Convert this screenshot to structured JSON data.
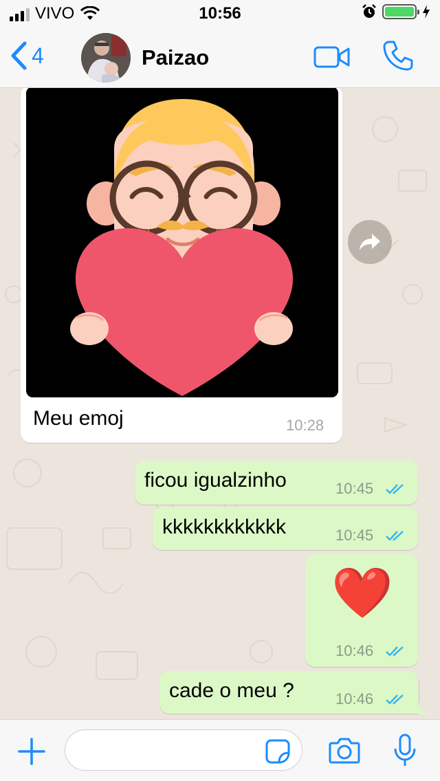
{
  "status_bar": {
    "carrier": "VIVO",
    "time": "10:56"
  },
  "header": {
    "back_count": "4",
    "contact_name": "Paizao"
  },
  "messages": [
    {
      "direction": "in",
      "type": "image",
      "caption": "Meu emoj",
      "time": "10:28"
    },
    {
      "direction": "out",
      "text": "ficou igualzinho",
      "time": "10:45",
      "read": true
    },
    {
      "direction": "out",
      "text": "kkkkkkkkkkkk",
      "time": "10:45",
      "read": true
    },
    {
      "direction": "out",
      "text": "❤️",
      "time": "10:46",
      "read": true
    },
    {
      "direction": "out",
      "text": "cade o meu ?",
      "time": "10:46",
      "read": true
    }
  ],
  "input": {
    "placeholder": ""
  },
  "colors": {
    "accent": "#1a8cfc",
    "outgoing_bubble": "#dcf8c6",
    "incoming_bubble": "#ffffff",
    "chat_background": "#ece5dd",
    "read_ticks": "#34b7f1",
    "battery": "#4cd964"
  },
  "icons": {
    "back": "chevron-left-icon",
    "video": "video-camera-icon",
    "call": "phone-icon",
    "forward": "forward-arrow-icon",
    "plus": "plus-icon",
    "sticker": "sticker-icon",
    "camera": "camera-icon",
    "mic": "microphone-icon"
  }
}
